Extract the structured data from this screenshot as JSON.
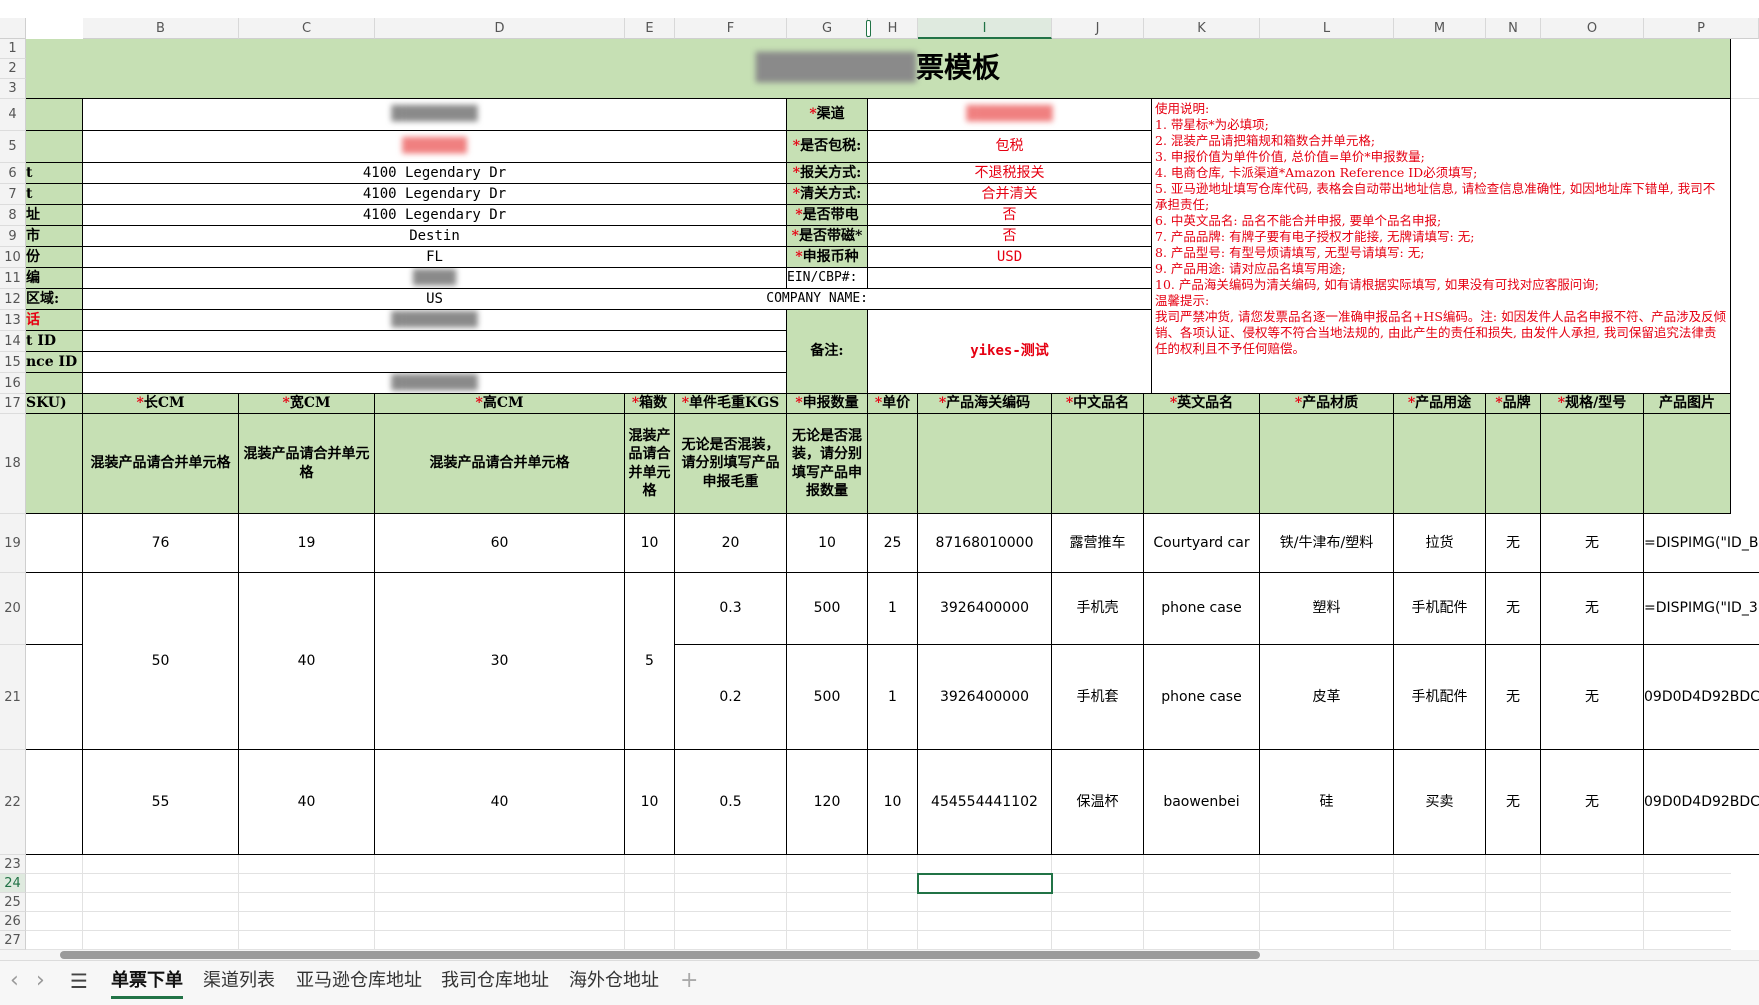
{
  "columns": [
    "B",
    "C",
    "D",
    "E",
    "F",
    "G",
    "H",
    "I",
    "J",
    "K",
    "L",
    "M",
    "N",
    "O",
    "P"
  ],
  "rows": [
    "1",
    "2",
    "3",
    "4",
    "5",
    "6",
    "7",
    "8",
    "9",
    "10",
    "11",
    "12",
    "13",
    "14",
    "15",
    "16",
    "17",
    "18",
    "19",
    "20",
    "21",
    "22",
    "23",
    "24",
    "25",
    "26",
    "27"
  ],
  "title": {
    "blurred": "████████",
    "visible": "票模板"
  },
  "info": {
    "r4_value": "████████",
    "r5_value": "██████",
    "r6_value": "4100 Legendary Dr",
    "r7_value": "4100 Legendary Dr",
    "r8_value": "4100 Legendary Dr",
    "r9_value": "Destin",
    "r10_value": "FL",
    "r11_value": "████",
    "r12_label": "区域:",
    "r12_value": "US",
    "r13_label": "话",
    "r13_value": "████████",
    "r14_label": "t ID",
    "r15_label": "nce ID",
    "r16_value": "████████",
    "r6_label": "t",
    "r7_label": "t",
    "r8_label": "址",
    "r9_label": "市",
    "r10_label": "份",
    "r11_label": "编"
  },
  "right_info": {
    "channel_label": "渠道",
    "channel_value": "████████",
    "tax_label": "是否包税:",
    "tax_value": "包税",
    "customs_label": "报关方式:",
    "customs_value": "不退税报关",
    "clearance_label": "清关方式:",
    "clearance_value": "合并清关",
    "battery_label": "是否带电",
    "battery_value": "否",
    "magnet_label": "是否带磁*",
    "magnet_value": "否",
    "currency_label": "申报币种",
    "currency_value": "USD",
    "ein_label": "EIN/CBP#:",
    "company_label": "COMPANY NAME:",
    "remark_label": "备注:",
    "remark_value": "yikes-测试"
  },
  "instructions": [
    "使用说明:",
    "1. 带星标*为必填项;",
    "2. 混装产品请把箱规和箱数合并单元格;",
    "3. 申报价值为单件价值, 总价值=单价*申报数量;",
    "4. 电商仓库, 卡派渠道*Amazon Reference ID必须填写;",
    "5. 亚马逊地址填写仓库代码, 表格会自动带出地址信息, 请检查信息准确性, 如因地址库下错单, 我司不承担责任;",
    "6. 中英文品名: 品名不能合并申报, 要单个品名申报;",
    "7. 产品品牌: 有牌子要有电子授权才能接, 无牌请填写: 无;",
    "8. 产品型号: 有型号烦请填写, 无型号请填写: 无;",
    "9. 产品用途: 请对应品名填写用途;",
    "10. 产品海关编码为清关编码, 如有请根据实际填写, 如果没有可找对应客服问询;",
    "温馨提示:",
    "我司严禁冲货, 请您发票品名逐一准确申报品名+HS编码。注: 如因发件人品名申报不符、产品涉及反倾销、各项认证、侵权等不符合当地法规的, 由此产生的责任和损失, 由发件人承担, 我司保留追究法律责任的权利且不予任何赔偿。"
  ],
  "headers": {
    "sku": "SKU)",
    "length": "长CM",
    "width": "宽CM",
    "height": "高CM",
    "boxes": "箱数",
    "weight": "单件毛重KGS",
    "qty": "申报数量",
    "price": "单价",
    "hs": "产品海关编码",
    "cn": "中文品名",
    "en": "英文品名",
    "material": "产品材质",
    "usage": "产品用途",
    "brand": "品牌",
    "model": "规格/型号",
    "image": "产品图片"
  },
  "notes": {
    "b": "混装产品请合并单元格",
    "c": "混装产品请合并单元格",
    "d": "混装产品请合并单元格",
    "e": "混装产品请合并单元格",
    "f": "无论是否混装，请分别填写产品申报毛重",
    "g": "无论是否混装，请分别填写产品申报数量"
  },
  "data": {
    "r19": {
      "len": "76",
      "wid": "19",
      "hgt": "60",
      "box": "10",
      "wt": "20",
      "qty": "10",
      "price": "25",
      "hs": "87168010000",
      "cn": "露营推车",
      "en": "Courtyard car",
      "mat": "铁/牛津布/塑料",
      "use": "拉货",
      "brand": "无",
      "model": "无",
      "img": "=DISPIMG(\"ID_B"
    },
    "g20_21": {
      "len": "50",
      "wid": "40",
      "hgt": "30",
      "box": "5"
    },
    "r20": {
      "wt": "0.3",
      "qty": "500",
      "price": "1",
      "hs": "3926400000",
      "cn": "手机壳",
      "en": "phone case",
      "mat": "塑料",
      "use": "手机配件",
      "brand": "无",
      "model": "无",
      "img": "=DISPIMG(\"ID_3"
    },
    "r21": {
      "wt": "0.2",
      "qty": "500",
      "price": "1",
      "hs": "3926400000",
      "cn": "手机套",
      "en": "phone case",
      "mat": "皮革",
      "use": "手机配件",
      "brand": "无",
      "model": "无",
      "img": "09D0D4D92BDC"
    },
    "r22": {
      "len": "55",
      "wid": "40",
      "hgt": "40",
      "box": "10",
      "wt": "0.5",
      "qty": "120",
      "price": "10",
      "hs": "454554441102",
      "cn": "保温杯",
      "en": "baowenbei",
      "mat": "硅",
      "use": "买卖",
      "brand": "无",
      "model": "无",
      "img": "09D0D4D92BDC"
    }
  },
  "sheet_tabs": [
    "单票下单",
    "渠道列表",
    "亚马逊仓库地址",
    "我司仓库地址",
    "海外仓地址"
  ],
  "active_tab": "单票下单",
  "icons": {
    "prev": "‹",
    "next": "›",
    "menu": "☰",
    "add": "+"
  }
}
